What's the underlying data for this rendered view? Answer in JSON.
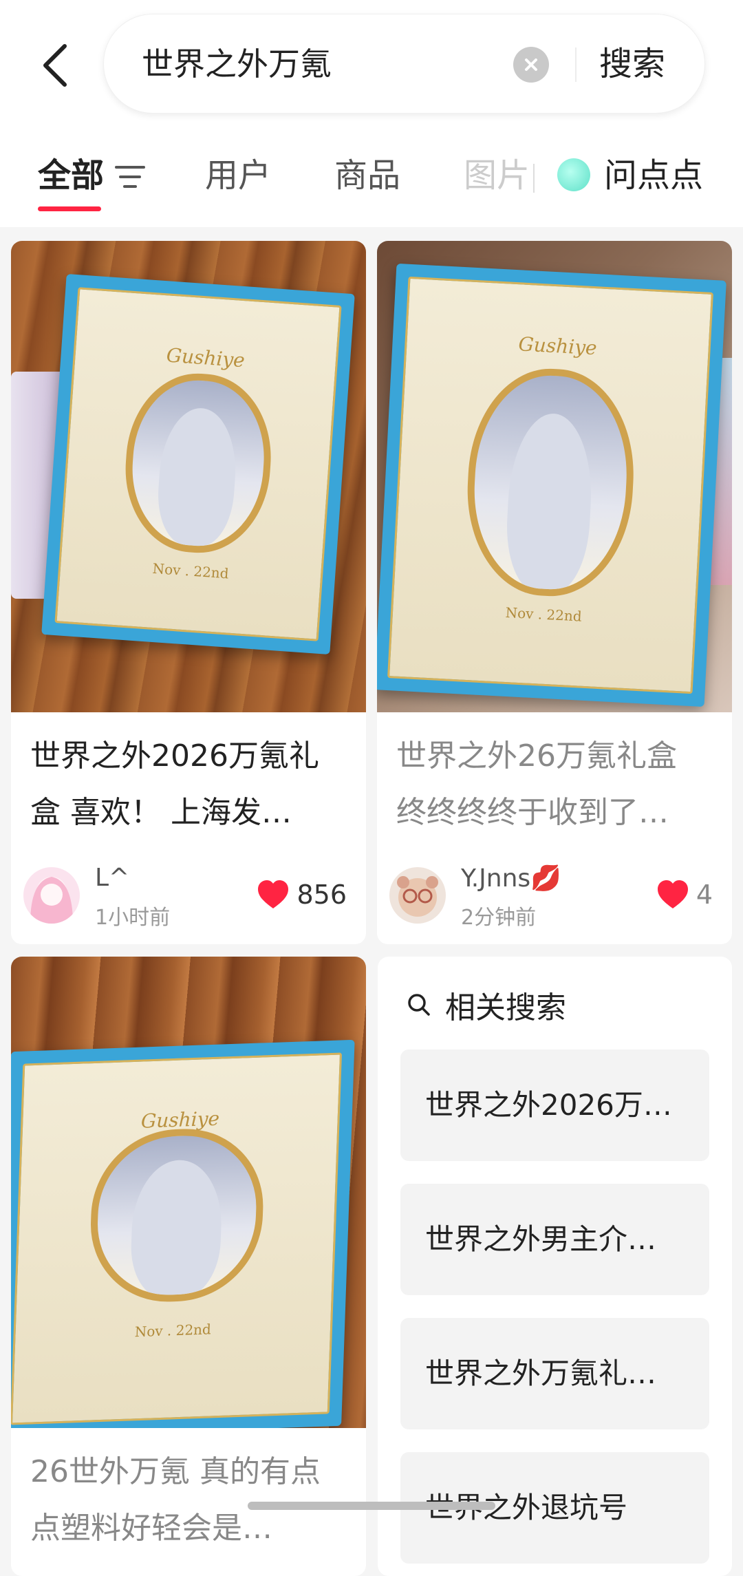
{
  "search": {
    "query": "世界之外万氪",
    "button_label": "搜索"
  },
  "tabs": [
    {
      "label": "全部"
    },
    {
      "label": "用户"
    },
    {
      "label": "商品"
    },
    {
      "label": "图片"
    },
    {
      "label": "问点点"
    }
  ],
  "posts": [
    {
      "title": "世界之外2026万氪礼盒 喜欢！ 上海发…",
      "author": "L^",
      "time": "1小时前",
      "likes": "856",
      "brand": "Gushiye",
      "date_mark": "Nov . 22nd"
    },
    {
      "title": "世界之外26万氪礼盒 终终终终于收到了…",
      "author": "Y.Jnns💋",
      "time": "2分钟前",
      "likes": "4",
      "brand": "Gushiye",
      "date_mark": "Nov . 22nd"
    },
    {
      "title": "26世外万氪 真的有点点塑料好轻会是…",
      "brand": "Gushiye",
      "date_mark": "Nov . 22nd"
    }
  ],
  "related": {
    "heading": "相关搜索",
    "items": [
      "世界之外2026万…",
      "世界之外男主介…",
      "世界之外万氪礼…",
      "世界之外退坑号"
    ]
  },
  "colors": {
    "accent": "#ff2442",
    "like": "#ff2442",
    "box_blue": "#3aa5d8",
    "gold": "#cfa24d"
  }
}
